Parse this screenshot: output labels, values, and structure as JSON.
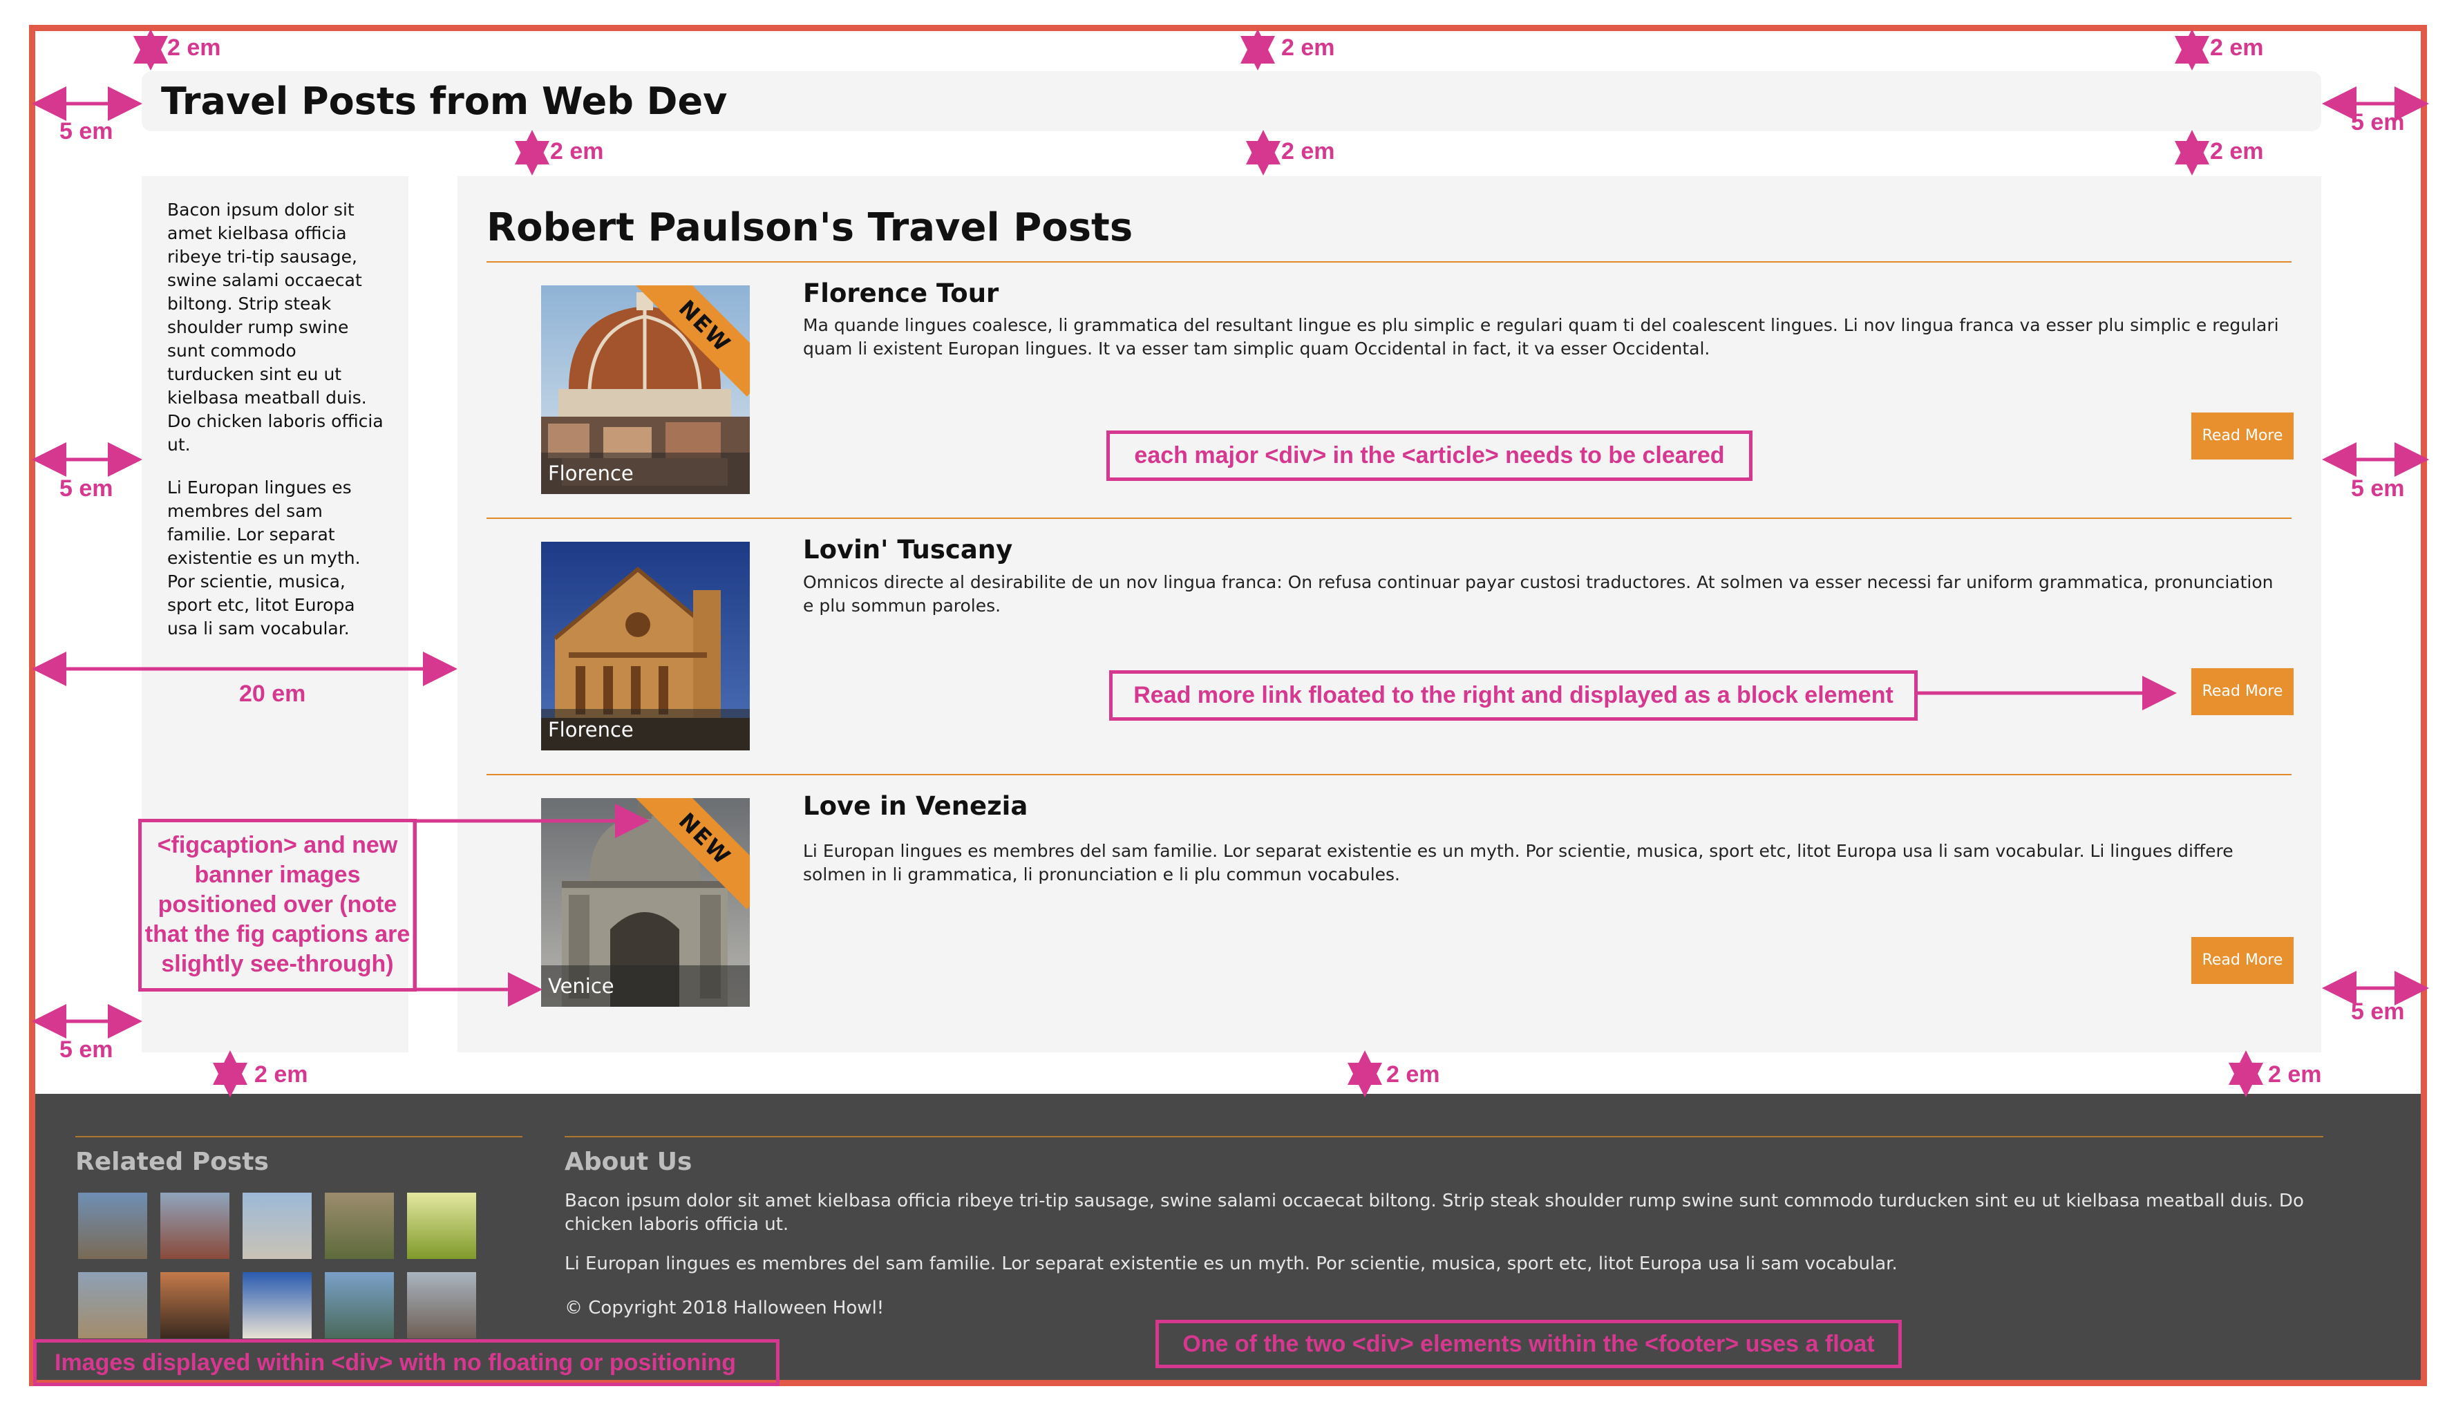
{
  "header": {
    "title": "Travel Posts from Web Dev"
  },
  "sidebar": {
    "paragraphs": [
      "Bacon ipsum dolor sit amet kielbasa officia ribeye tri-tip sausage, swine salami occaecat biltong. Strip steak shoulder rump swine sunt commodo turducken sint eu ut kielbasa meatball duis. Do chicken laboris officia ut.",
      "Li Europan lingues es membres del sam familie. Lor separat existentie es un myth. Por scientie, musica, sport etc, litot Europa usa li sam vocabular."
    ]
  },
  "main": {
    "title": "Robert Paulson's Travel Posts",
    "posts": [
      {
        "title": "Florence Tour",
        "text": "Ma quande lingues coalesce, li grammatica del resultant lingue es plu simplic e regulari quam ti del coalescent lingues. Li nov lingua franca va esser plu simplic e regulari quam li existent Europan lingues. It va esser tam simplic quam Occidental in fact, it va esser Occidental.",
        "caption": "Florence",
        "banner": "NEW",
        "read_more": "Read More"
      },
      {
        "title": "Lovin' Tuscany",
        "text": "Omnicos directe al desirabilite de un nov lingua franca: On refusa continuar payar custosi traductores. At solmen va esser necessi far uniform grammatica, pronunciation e plu sommun paroles.",
        "caption": "Florence",
        "read_more": "Read More"
      },
      {
        "title": "Love in Venezia",
        "text": "Li Europan lingues es membres del sam familie. Lor separat existentie es un myth. Por scientie, musica, sport etc, litot Europa usa li sam vocabular. Li lingues differe solmen in li grammatica, li pronunciation e li plu commun vocabules.",
        "caption": "Venice",
        "banner": "NEW",
        "read_more": "Read More"
      }
    ]
  },
  "footer": {
    "related_title": "Related Posts",
    "about_title": "About Us",
    "about_paragraphs": [
      "Bacon ipsum dolor sit amet kielbasa officia ribeye tri-tip sausage, swine salami occaecat biltong. Strip steak shoulder rump swine sunt commodo turducken sint eu ut kielbasa meatball duis. Do chicken laboris officia ut.",
      "Li Europan lingues es membres del sam familie. Lor separat existentie es un myth. Por scientie, musica, sport etc, litot Europa usa li sam vocabular."
    ],
    "copyright": "© Copyright 2018 Halloween Howl!"
  },
  "annotations": {
    "two_em": "2 em",
    "five_em": "5 em",
    "twenty_em": "20 em",
    "clear_note": "each major <div> in the <article> needs to be cleared",
    "readmore_note": "Read more link floated to the right and displayed as a block element",
    "figcaption_note": "<figcaption> and new banner images positioned over (note that the fig captions are slightly see-through)",
    "images_note": "Images displayed within <div> with no floating or positioning",
    "footer_note": "One of the two <div> elements within the <footer> uses a float"
  },
  "colors": {
    "frame": "#e05a47",
    "accent": "#e7902d",
    "annotation": "#d6378f",
    "footer_bg": "#484848",
    "panel_bg": "#f4f4f4"
  }
}
